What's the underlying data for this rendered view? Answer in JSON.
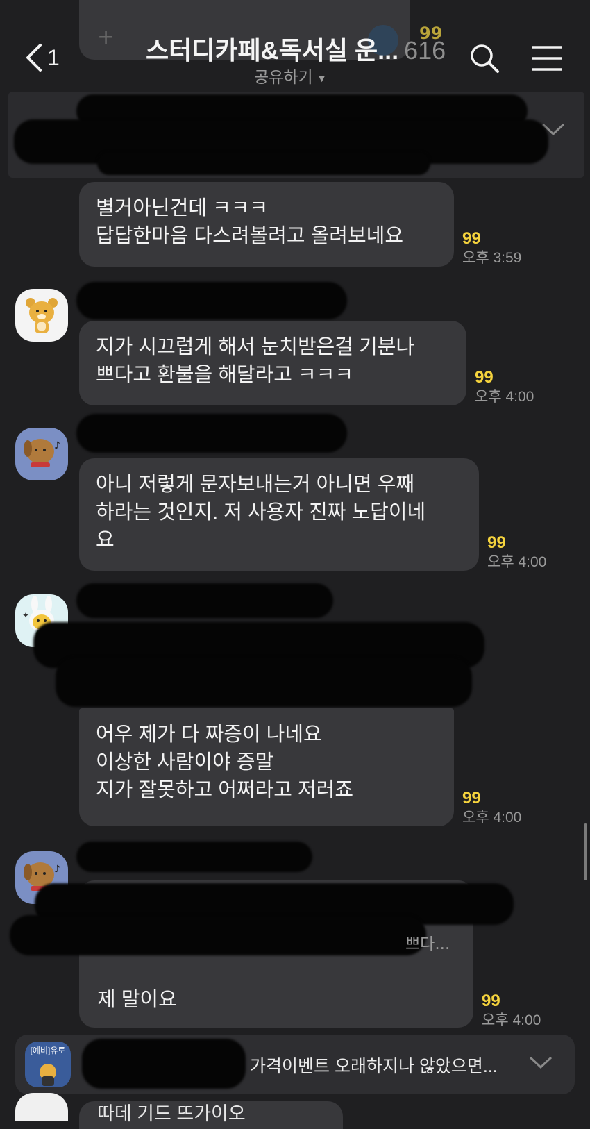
{
  "header": {
    "back_count": "1",
    "title": "스터디카페&독서실 운...",
    "member_count": "616",
    "share_label": "공유하기"
  },
  "messages": [
    {
      "text": "별거아닌건데 ㅋㅋㅋ\n답답한마음 다스려볼려고 올려보네요",
      "unread": "99",
      "time": "오후 3:59"
    },
    {
      "text": "지가 시끄럽게 해서 눈치받은걸 기분나\n쁘다고 환불을 해달라고 ㅋㅋㅋ",
      "unread": "99",
      "time": "오후 4:00"
    },
    {
      "text": "아니 저렇게 문자보내는거 아니면 우째\n하라는 것인지. 저 사용자 진짜 노답이네\n요",
      "unread": "99",
      "time": "오후 4:00"
    },
    {
      "text": "어우 제가 다 짜증이 나네요\n이상한 사람이야 증말\n지가 잘못하고 어쩌라고 저러죠",
      "unread": "99",
      "time": "오후 4:00"
    },
    {
      "reply_preview_tail": "쁘다...",
      "text": "제 말이요",
      "unread": "99",
      "time": "오후 4:00"
    }
  ],
  "top_partial": {
    "unread": "99"
  },
  "notification": {
    "avatar_label": "[예비]유토",
    "preview_text": "가격이벤트 오래하지나 않았으면..."
  },
  "next_message_partial": "따데 기드 뜨가이오"
}
